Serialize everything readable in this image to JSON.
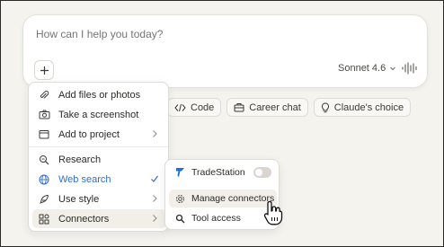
{
  "composer": {
    "placeholder": "How can I help you today?",
    "model_label": "Sonnet 4.6"
  },
  "pills": [
    {
      "label": "Code",
      "icon": "code-icon"
    },
    {
      "label": "Career chat",
      "icon": "briefcase-icon"
    },
    {
      "label": "Claude's choice",
      "icon": "lightbulb-icon"
    }
  ],
  "menu": {
    "items": [
      {
        "label": "Add files or photos",
        "icon": "paperclip-icon"
      },
      {
        "label": "Take a screenshot",
        "icon": "camera-icon"
      },
      {
        "label": "Add to project",
        "icon": "folder-icon"
      },
      {
        "label": "Research",
        "icon": "research-icon"
      },
      {
        "label": "Web search",
        "icon": "globe-icon",
        "checked": true
      },
      {
        "label": "Use style",
        "icon": "feather-icon"
      },
      {
        "label": "Connectors",
        "icon": "connectors-icon"
      }
    ]
  },
  "submenu": {
    "items": [
      {
        "label": "TradeStation",
        "icon": "tradestation-icon",
        "enabled": false
      },
      {
        "label": "Manage connectors",
        "icon": "gear-icon"
      },
      {
        "label": "Tool access",
        "icon": "search-icon"
      }
    ]
  },
  "colors": {
    "accent_blue": "#2f6fd1",
    "tradestation_blue": "#1e6fd9",
    "background": "#f4f3ee"
  }
}
